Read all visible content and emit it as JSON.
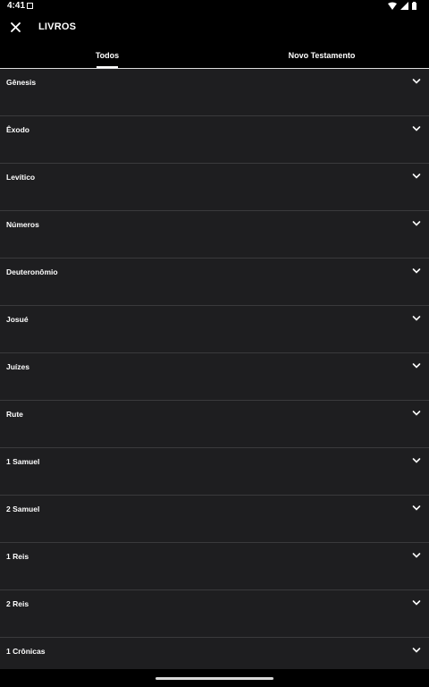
{
  "status": {
    "time": "4:41"
  },
  "header": {
    "title": "LIVROS"
  },
  "tabs": [
    {
      "label": "Todos",
      "selected": true
    },
    {
      "label": "Novo Testamento",
      "selected": false
    }
  ],
  "books": [
    {
      "label": "Gênesis"
    },
    {
      "label": "Êxodo"
    },
    {
      "label": "Levítico"
    },
    {
      "label": "Números"
    },
    {
      "label": "Deuteronômio"
    },
    {
      "label": "Josué"
    },
    {
      "label": "Juízes"
    },
    {
      "label": "Rute"
    },
    {
      "label": "1 Samuel"
    },
    {
      "label": "2 Samuel"
    },
    {
      "label": "1 Reis"
    },
    {
      "label": "2 Reis"
    },
    {
      "label": "1 Crônicas"
    }
  ],
  "icons": {
    "close": "close-icon",
    "expand": "chevron-down-icon",
    "wifi": "wifi-icon",
    "signal": "signal-icon",
    "battery": "battery-icon"
  },
  "colors": {
    "background": "#000000",
    "row": "#1e1e20",
    "divider": "#3a3a3c",
    "text": "#ffffff"
  }
}
